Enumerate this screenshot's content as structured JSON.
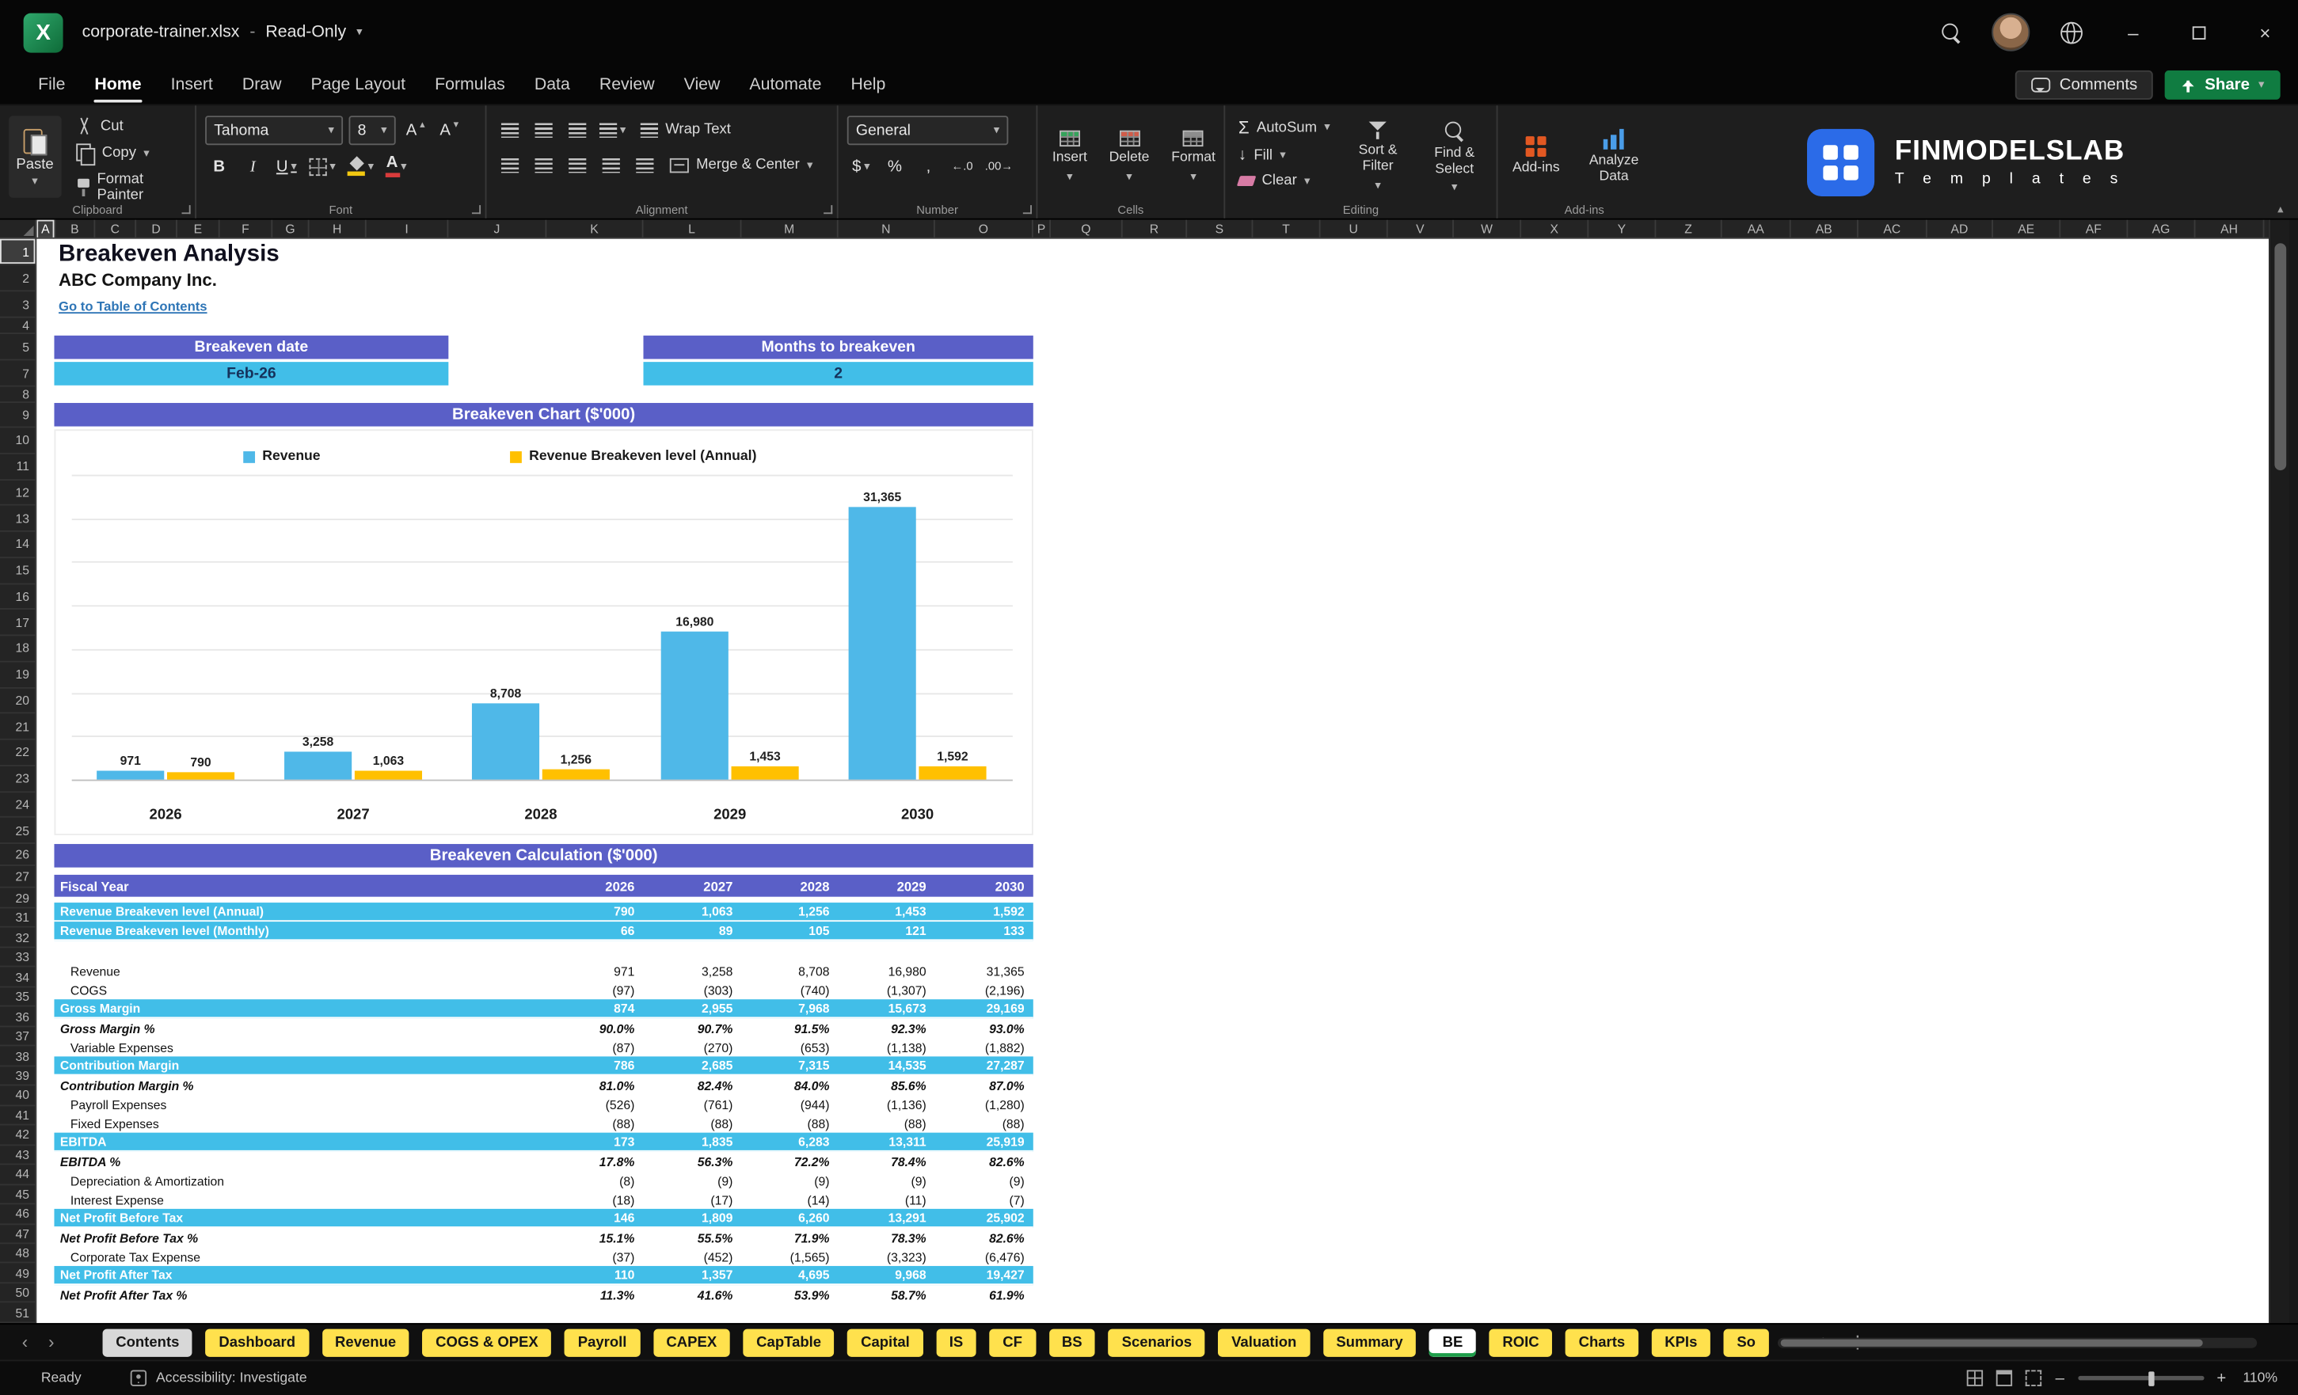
{
  "colors": {
    "accent_purple": "#5A5FC7",
    "band_cyan": "#41BEE8",
    "bar_blue": "#4FB8E8",
    "bar_yellow": "#FFC000",
    "tab_yellow": "#FFE14D",
    "excel_green": "#107C41",
    "link_blue": "#2E75B6"
  },
  "icons": {
    "chevron_down": "▾",
    "chevron_up": "▴",
    "tab_prev": "‹",
    "tab_next": "›",
    "overflow": "•••",
    "add_sheet": "+",
    "more_vert": "⋮",
    "minimize": "–",
    "close": "×",
    "sum": "Σ",
    "dollar": "$",
    "percent": "%",
    "comma": ",",
    "letter_a": "A",
    "arrow_down": "↓",
    "increase_decimal": "←.0",
    "decrease_decimal": ".00→"
  },
  "titlebar": {
    "app_icon_letter": "X",
    "doc_title": "corporate-trainer.xlsx",
    "separator": "-",
    "mode": "Read-Only"
  },
  "menu": {
    "items": [
      "File",
      "Home",
      "Insert",
      "Draw",
      "Page Layout",
      "Formulas",
      "Data",
      "Review",
      "View",
      "Automate",
      "Help"
    ],
    "active": "Home",
    "comments": "Comments",
    "share": "Share"
  },
  "ribbon": {
    "clipboard": {
      "group": "Clipboard",
      "paste": "Paste",
      "cut": "Cut",
      "copy": "Copy",
      "format_painter": "Format Painter"
    },
    "font": {
      "group": "Font",
      "name": "Tahoma",
      "size": "8",
      "bold": "B",
      "italic": "I",
      "underline": "U"
    },
    "alignment": {
      "group": "Alignment",
      "wrap": "Wrap Text",
      "merge": "Merge & Center"
    },
    "number": {
      "group": "Number",
      "format": "General"
    },
    "cells": {
      "group": "Cells",
      "insert": "Insert",
      "delete": "Delete",
      "format": "Format"
    },
    "editing": {
      "group": "Editing",
      "autosum": "AutoSum",
      "fill": "Fill",
      "clear": "Clear",
      "sort": "Sort & Filter",
      "find": "Find & Select"
    },
    "addins": {
      "group": "Add-ins",
      "addins": "Add-ins",
      "analyze": "Analyze Data"
    },
    "brand": {
      "name": "FINMODELSLAB",
      "tagline": "T e m p l a t e s"
    }
  },
  "grid": {
    "columns": [
      "A",
      "B",
      "C",
      "D",
      "E",
      "F",
      "G",
      "H",
      "I",
      "J",
      "K",
      "L",
      "M",
      "N",
      "O",
      "P",
      "Q",
      "R",
      "S",
      "T",
      "U",
      "V",
      "W",
      "X",
      "Y",
      "Z",
      "AA",
      "AB",
      "AC",
      "AD",
      "AE",
      "AF",
      "AG",
      "AH"
    ],
    "active_column": "A",
    "rows": [
      "1",
      "2",
      "3",
      "4",
      "5",
      "7",
      "8",
      "9",
      "10",
      "11",
      "12",
      "13",
      "14",
      "15",
      "16",
      "17",
      "18",
      "19",
      "20",
      "21",
      "22",
      "23",
      "24",
      "25",
      "26",
      "27",
      "29",
      "31",
      "32",
      "33",
      "34",
      "35",
      "36",
      "37",
      "38",
      "39",
      "40",
      "41",
      "42",
      "43",
      "44",
      "45",
      "46",
      "47",
      "48",
      "49",
      "50",
      "51"
    ],
    "active_row": "1"
  },
  "sheet": {
    "title": "Breakeven Analysis",
    "company": "ABC Company Inc.",
    "toc_link": "Go to Table of Contents",
    "kpis": [
      {
        "label": "Breakeven date",
        "value": "Feb-26"
      },
      {
        "label": "Months to breakeven",
        "value": "2"
      }
    ]
  },
  "chart_data": {
    "type": "bar",
    "title": "Breakeven Chart ($'000)",
    "categories": [
      "2026",
      "2027",
      "2028",
      "2029",
      "2030"
    ],
    "series": [
      {
        "name": "Revenue",
        "color": "#4FB8E8",
        "values": [
          971,
          3258,
          8708,
          16980,
          31365
        ],
        "labels": [
          "971",
          "3,258",
          "8,708",
          "16,980",
          "31,365"
        ]
      },
      {
        "name": "Revenue Breakeven level (Annual)",
        "color": "#FFC000",
        "values": [
          790,
          1063,
          1256,
          1453,
          1592
        ],
        "labels": [
          "790",
          "1,063",
          "1,256",
          "1,453",
          "1,592"
        ]
      }
    ],
    "xlabel": "",
    "ylabel": "",
    "ylim": [
      0,
      35000
    ],
    "gridline_step": 5000,
    "grid": true,
    "legend_position": "top"
  },
  "calc_table": {
    "title": "Breakeven Calculation ($'000)",
    "header": {
      "label": "Fiscal Year",
      "years": [
        "2026",
        "2027",
        "2028",
        "2029",
        "2030"
      ]
    },
    "rows": [
      {
        "style": "total",
        "label": "Revenue Breakeven level (Annual)",
        "values": [
          "790",
          "1,063",
          "1,256",
          "1,453",
          "1,592"
        ]
      },
      {
        "style": "total",
        "label": "Revenue Breakeven level (Monthly)",
        "values": [
          "66",
          "89",
          "105",
          "121",
          "133"
        ]
      },
      {
        "style": "spacer",
        "label": "",
        "values": [
          "",
          "",
          "",
          "",
          ""
        ]
      },
      {
        "style": "plain",
        "label": "Revenue",
        "values": [
          "971",
          "3,258",
          "8,708",
          "16,980",
          "31,365"
        ]
      },
      {
        "style": "plain",
        "label": "COGS",
        "values": [
          "(97)",
          "(303)",
          "(740)",
          "(1,307)",
          "(2,196)"
        ]
      },
      {
        "style": "total",
        "label": "Gross Margin",
        "values": [
          "874",
          "2,955",
          "7,968",
          "15,673",
          "29,169"
        ]
      },
      {
        "style": "pct",
        "label": "Gross Margin %",
        "values": [
          "90.0%",
          "90.7%",
          "91.5%",
          "92.3%",
          "93.0%"
        ]
      },
      {
        "style": "plain",
        "label": "Variable Expenses",
        "values": [
          "(87)",
          "(270)",
          "(653)",
          "(1,138)",
          "(1,882)"
        ]
      },
      {
        "style": "total",
        "label": "Contribution Margin",
        "values": [
          "786",
          "2,685",
          "7,315",
          "14,535",
          "27,287"
        ]
      },
      {
        "style": "pct",
        "label": "Contribution Margin %",
        "values": [
          "81.0%",
          "82.4%",
          "84.0%",
          "85.6%",
          "87.0%"
        ]
      },
      {
        "style": "plain",
        "label": "Payroll Expenses",
        "values": [
          "(526)",
          "(761)",
          "(944)",
          "(1,136)",
          "(1,280)"
        ]
      },
      {
        "style": "plain",
        "label": "Fixed Expenses",
        "values": [
          "(88)",
          "(88)",
          "(88)",
          "(88)",
          "(88)"
        ]
      },
      {
        "style": "total",
        "label": "EBITDA",
        "values": [
          "173",
          "1,835",
          "6,283",
          "13,311",
          "25,919"
        ]
      },
      {
        "style": "pct",
        "label": "EBITDA %",
        "values": [
          "17.8%",
          "56.3%",
          "72.2%",
          "78.4%",
          "82.6%"
        ]
      },
      {
        "style": "plain",
        "label": "Depreciation & Amortization",
        "values": [
          "(8)",
          "(9)",
          "(9)",
          "(9)",
          "(9)"
        ]
      },
      {
        "style": "plain",
        "label": "Interest Expense",
        "values": [
          "(18)",
          "(17)",
          "(14)",
          "(11)",
          "(7)"
        ]
      },
      {
        "style": "total",
        "label": "Net Profit Before Tax",
        "values": [
          "146",
          "1,809",
          "6,260",
          "13,291",
          "25,902"
        ]
      },
      {
        "style": "pct",
        "label": "Net Profit Before Tax %",
        "values": [
          "15.1%",
          "55.5%",
          "71.9%",
          "78.3%",
          "82.6%"
        ]
      },
      {
        "style": "plain",
        "label": "Corporate Tax Expense",
        "values": [
          "(37)",
          "(452)",
          "(1,565)",
          "(3,323)",
          "(6,476)"
        ]
      },
      {
        "style": "total",
        "label": "Net Profit After Tax",
        "values": [
          "110",
          "1,357",
          "4,695",
          "9,968",
          "19,427"
        ]
      },
      {
        "style": "pct",
        "label": "Net Profit After Tax %",
        "values": [
          "11.3%",
          "41.6%",
          "53.9%",
          "58.7%",
          "61.9%"
        ]
      }
    ]
  },
  "tabs": {
    "items": [
      {
        "label": "Contents",
        "style": "light"
      },
      {
        "label": "Dashboard",
        "style": "yellow"
      },
      {
        "label": "Revenue",
        "style": "yellow"
      },
      {
        "label": "COGS & OPEX",
        "style": "yellow"
      },
      {
        "label": "Payroll",
        "style": "yellow"
      },
      {
        "label": "CAPEX",
        "style": "yellow"
      },
      {
        "label": "CapTable",
        "style": "yellow"
      },
      {
        "label": "Capital",
        "style": "yellow"
      },
      {
        "label": "IS",
        "style": "yellow"
      },
      {
        "label": "CF",
        "style": "yellow"
      },
      {
        "label": "BS",
        "style": "yellow"
      },
      {
        "label": "Scenarios",
        "style": "yellow"
      },
      {
        "label": "Valuation",
        "style": "yellow"
      },
      {
        "label": "Summary",
        "style": "yellow"
      },
      {
        "label": "BE",
        "style": "active"
      },
      {
        "label": "ROIC",
        "style": "yellow"
      },
      {
        "label": "Charts",
        "style": "yellow"
      },
      {
        "label": "KPIs",
        "style": "yellow"
      },
      {
        "label": "So",
        "style": "yellow"
      }
    ]
  },
  "statusbar": {
    "ready": "Ready",
    "accessibility": "Accessibility: Investigate",
    "zoom": "110%"
  }
}
